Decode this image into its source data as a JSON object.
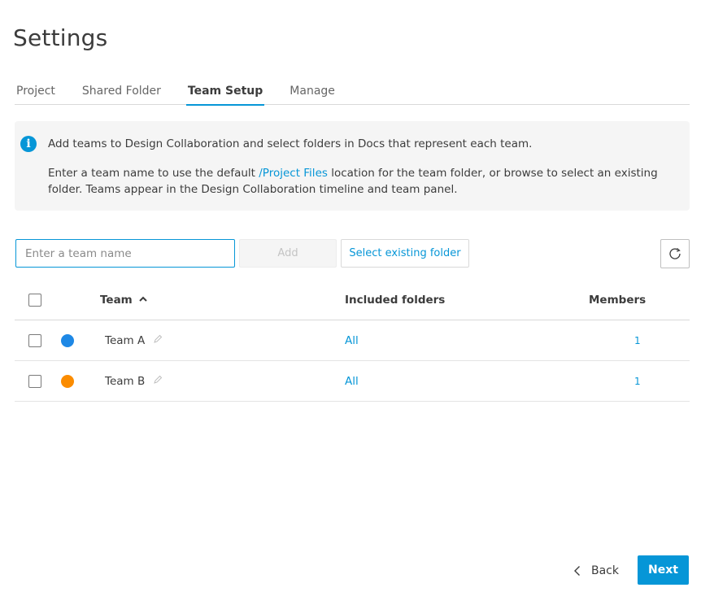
{
  "page": {
    "title": "Settings"
  },
  "tabs": [
    {
      "label": "Project",
      "active": false
    },
    {
      "label": "Shared Folder",
      "active": false
    },
    {
      "label": "Team Setup",
      "active": true
    },
    {
      "label": "Manage",
      "active": false
    }
  ],
  "info": {
    "icon": "info-icon",
    "line1": "Add teams to Design Collaboration and select folders in Docs that represent each team.",
    "line2_prefix": "Enter a team name to use the default ",
    "line2_link": "/Project Files",
    "line2_suffix": " location for the team folder, or browse to select an existing folder. Teams appear in the Design Collaboration timeline and team panel."
  },
  "toolbar": {
    "team_input_value": "",
    "team_input_placeholder": "Enter a team name",
    "add_label": "Add",
    "select_folder_label": "Select existing folder",
    "refresh_icon": "refresh-icon"
  },
  "table": {
    "headers": {
      "team": "Team",
      "folders": "Included folders",
      "members": "Members"
    },
    "sort": {
      "column": "team",
      "direction": "ascending"
    },
    "rows": [
      {
        "name": "Team A",
        "color": "#1e88e5",
        "folders": "All",
        "members": "1",
        "checked": false
      },
      {
        "name": "Team B",
        "color": "#fb8c00",
        "folders": "All",
        "members": "1",
        "checked": false
      }
    ]
  },
  "footer": {
    "back_label": "Back",
    "next_label": "Next"
  },
  "colors": {
    "accent": "#0696d7"
  }
}
